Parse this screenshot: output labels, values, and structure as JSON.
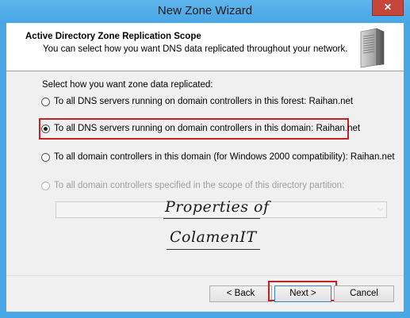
{
  "window": {
    "title": "New Zone Wizard",
    "close_glyph": "✕"
  },
  "header": {
    "title": "Active Directory Zone Replication Scope",
    "subtitle": "You can select how you want DNS data replicated throughout your network.",
    "icon": "server-icon"
  },
  "body": {
    "prompt": "Select how you want zone data replicated:",
    "options": [
      {
        "label": "To all DNS servers running on domain controllers in this forest: Raihan.net",
        "checked": false,
        "enabled": true
      },
      {
        "label": "To all DNS servers running on domain controllers in this domain: Raihan.net",
        "checked": true,
        "enabled": true
      },
      {
        "label": "To all domain controllers in this domain (for Windows 2000 compatibility): Raihan.net",
        "checked": false,
        "enabled": true
      },
      {
        "label": "To all domain controllers specified in the scope of this directory partition:",
        "checked": false,
        "enabled": false
      }
    ],
    "partition_select_value": "",
    "watermark_line1": "Properties of",
    "watermark_line2": "ColamenIT"
  },
  "buttons": {
    "back": "< Back",
    "next": "Next >",
    "cancel": "Cancel"
  },
  "colors": {
    "titlebar": "#48a6e6",
    "highlight": "#c62121",
    "close_button": "#c7463b"
  }
}
